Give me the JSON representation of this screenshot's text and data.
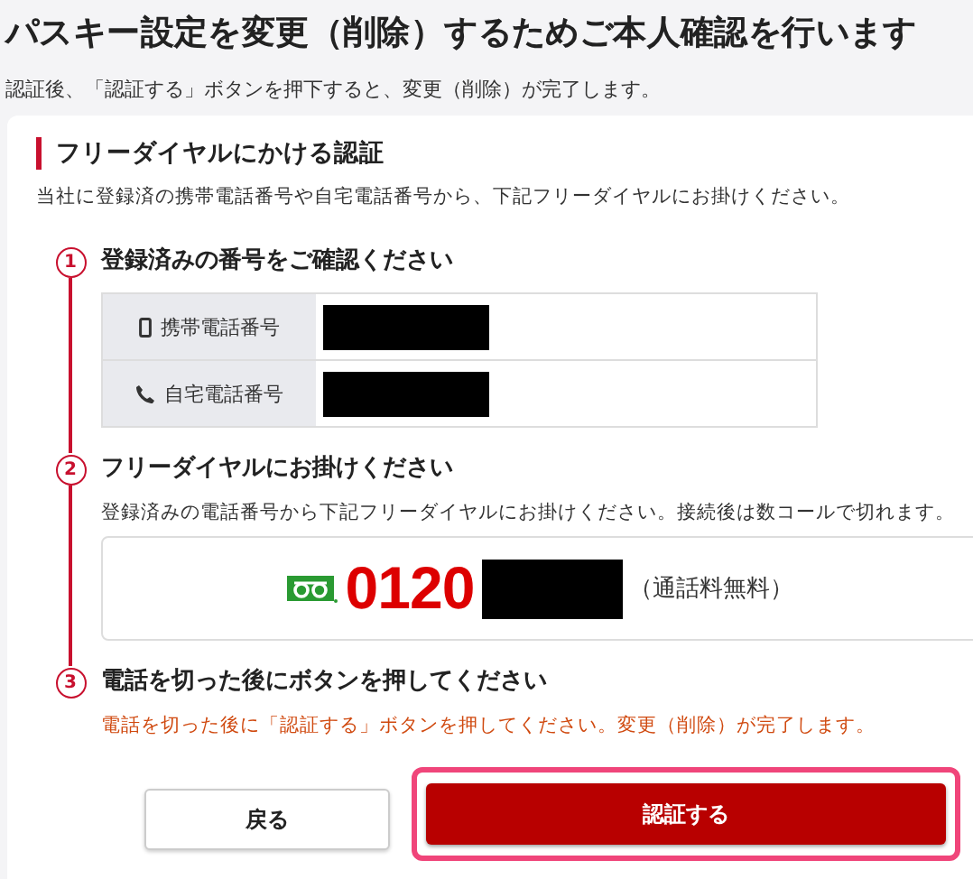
{
  "page": {
    "title": "パスキー設定を変更（削除）するためご本人確認を行います",
    "subtitle": "認証後、「認証する」ボタンを押下すると、変更（削除）が完了します。"
  },
  "card": {
    "heading": "フリーダイヤルにかける認証",
    "description": "当社に登録済の携帯電話番号や自宅電話番号から、下記フリーダイヤルにお掛けください。"
  },
  "steps": [
    {
      "number": "1",
      "title": "登録済みの番号をご確認ください",
      "kind": "phones",
      "phones": [
        {
          "kind": "mobile",
          "label": "携帯電話番号"
        },
        {
          "kind": "home",
          "label": "自宅電話番号"
        }
      ]
    },
    {
      "number": "2",
      "title": "フリーダイヤルにお掛けください",
      "kind": "freedial",
      "description": "登録済みの電話番号から下記フリーダイヤルにお掛けください。接続後は数コールで切れます。",
      "number_prefix": "0120",
      "note": "（通話料無料）"
    },
    {
      "number": "3",
      "title": "電話を切った後にボタンを押してください",
      "kind": "notice",
      "description": "電話を切った後に「認証する」ボタンを押してください。変更（削除）が完了します。"
    }
  ],
  "buttons": [
    {
      "label": "戻る",
      "kind": "secondary",
      "highlighted": false
    },
    {
      "label": "認証する",
      "kind": "primary",
      "highlighted": true
    }
  ]
}
